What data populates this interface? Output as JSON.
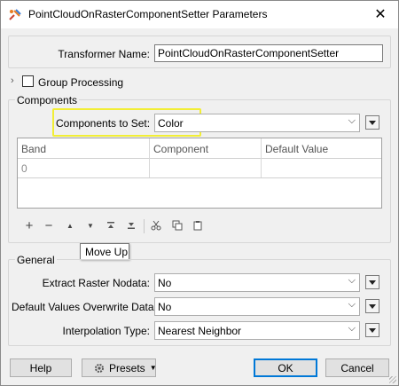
{
  "window": {
    "title": "PointCloudOnRasterComponentSetter Parameters",
    "close_glyph": "✕",
    "icon": "fme-transformer-icon"
  },
  "transformer": {
    "label": "Transformer Name:",
    "value": "PointCloudOnRasterComponentSetter"
  },
  "group_processing": {
    "label": "Group Processing",
    "checked": false
  },
  "components": {
    "heading": "Components",
    "to_set_label": "Components to Set:",
    "to_set_value": "Color",
    "highlight_color": "#f2ee35",
    "table": {
      "headers": [
        "Band",
        "Component",
        "Default Value"
      ],
      "rows": [
        [
          "0",
          "",
          ""
        ]
      ]
    },
    "toolbar_tooltip": "Move Up"
  },
  "general": {
    "heading": "General",
    "extract_nodata": {
      "label": "Extract Raster Nodata:",
      "value": "No"
    },
    "overwrite": {
      "label": "Default Values Overwrite Data:",
      "value": "No"
    },
    "interpolation": {
      "label": "Interpolation Type:",
      "value": "Nearest Neighbor"
    }
  },
  "buttons": {
    "help": "Help",
    "presets": "Presets",
    "ok": "OK",
    "cancel": "Cancel"
  }
}
